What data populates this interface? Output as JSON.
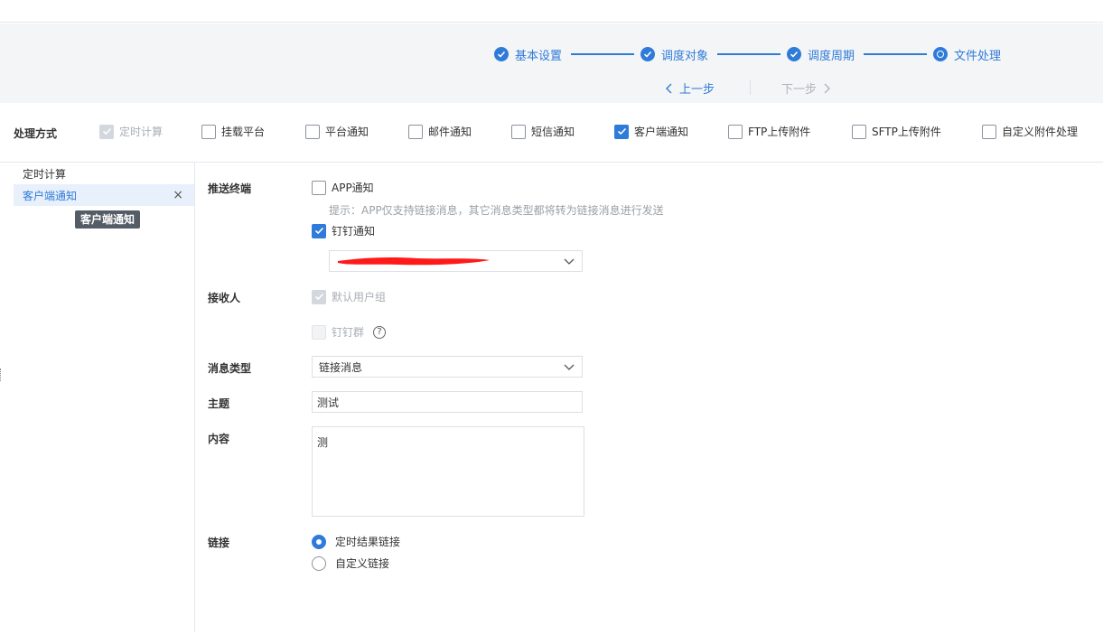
{
  "steps": [
    {
      "label": "基本设置",
      "state": "done"
    },
    {
      "label": "调度对象",
      "state": "done"
    },
    {
      "label": "调度周期",
      "state": "done"
    },
    {
      "label": "文件处理",
      "state": "current"
    }
  ],
  "nav": {
    "prev": "上一步",
    "next": "下一步"
  },
  "methods": {
    "label": "处理方式",
    "items": [
      {
        "label": "定时计算",
        "checked": true,
        "disabled": true
      },
      {
        "label": "挂载平台",
        "checked": false
      },
      {
        "label": "平台通知",
        "checked": false
      },
      {
        "label": "邮件通知",
        "checked": false
      },
      {
        "label": "短信通知",
        "checked": false
      },
      {
        "label": "客户端通知",
        "checked": true
      },
      {
        "label": "FTP上传附件",
        "checked": false
      },
      {
        "label": "SFTP上传附件",
        "checked": false
      },
      {
        "label": "自定义附件处理",
        "checked": false
      }
    ]
  },
  "left_list": {
    "items": [
      {
        "label": "定时计算",
        "active": false
      },
      {
        "label": "客户端通知",
        "active": true
      }
    ],
    "tooltip": "客户端通知",
    "close_symbol": "×"
  },
  "form": {
    "push_terminal": {
      "label": "推送终端",
      "app": {
        "label": "APP通知",
        "checked": false
      },
      "hint": "提示：APP仅支持链接消息，其它消息类型都将转为链接消息进行发送",
      "dingtalk": {
        "label": "钉钉通知",
        "checked": true
      }
    },
    "receiver": {
      "label": "接收人",
      "default_group": {
        "label": "默认用户组",
        "checked": true,
        "disabled": true
      },
      "ding_group": {
        "label": "钉钉群",
        "checked": false,
        "disabled": true,
        "help": "?"
      }
    },
    "message_type": {
      "label": "消息类型",
      "value": "链接消息"
    },
    "subject": {
      "label": "主题",
      "value": "测试"
    },
    "content": {
      "label": "内容",
      "value": "测"
    },
    "link": {
      "label": "链接",
      "options": [
        {
          "label": "定时结果链接",
          "selected": true
        },
        {
          "label": "自定义链接",
          "selected": false
        }
      ]
    }
  },
  "colors": {
    "accent": "#2f7bd9",
    "band": "#f4f5f7",
    "redaction": "#ff0000"
  }
}
